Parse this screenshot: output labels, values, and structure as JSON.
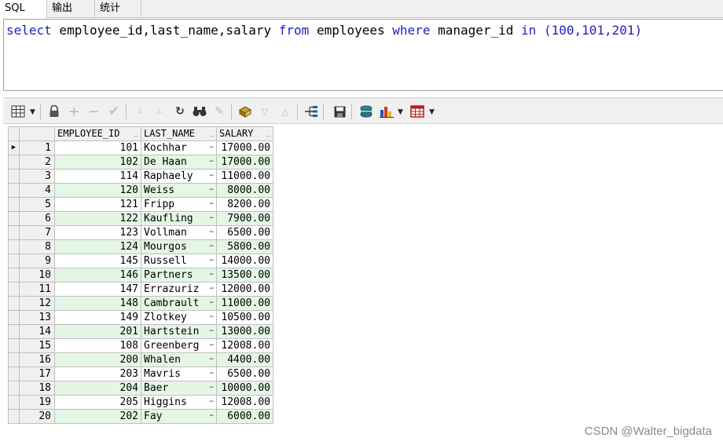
{
  "tabs": [
    "SQL",
    "输出",
    "统计"
  ],
  "sql": {
    "kw_select": "select",
    "cols": " employee_id,last_name,salary ",
    "kw_from": "from",
    "table": " employees ",
    "kw_where": "where",
    "cond": " manager_id ",
    "kw_in": "in",
    "list": " (100,101,201)"
  },
  "toolbar": {
    "icons": [
      "grid-icon",
      "lock-icon",
      "plus-icon",
      "minus-icon",
      "check-icon",
      "filter-down-icon",
      "filter-all-icon",
      "refresh-icon",
      "find-icon",
      "clear-icon",
      "query-icon",
      "down-icon",
      "up-icon",
      "explain-icon",
      "save-icon",
      "export-icon",
      "chart-icon",
      "table-icon"
    ]
  },
  "grid": {
    "columns": [
      "EMPLOYEE_ID",
      "LAST_NAME",
      "SALARY"
    ],
    "rows": [
      [
        "1",
        "101",
        "Kochhar",
        "17000.00"
      ],
      [
        "2",
        "102",
        "De Haan",
        "17000.00"
      ],
      [
        "3",
        "114",
        "Raphaely",
        "11000.00"
      ],
      [
        "4",
        "120",
        "Weiss",
        "8000.00"
      ],
      [
        "5",
        "121",
        "Fripp",
        "8200.00"
      ],
      [
        "6",
        "122",
        "Kaufling",
        "7900.00"
      ],
      [
        "7",
        "123",
        "Vollman",
        "6500.00"
      ],
      [
        "8",
        "124",
        "Mourgos",
        "5800.00"
      ],
      [
        "9",
        "145",
        "Russell",
        "14000.00"
      ],
      [
        "10",
        "146",
        "Partners",
        "13500.00"
      ],
      [
        "11",
        "147",
        "Errazuriz",
        "12000.00"
      ],
      [
        "12",
        "148",
        "Cambrault",
        "11000.00"
      ],
      [
        "13",
        "149",
        "Zlotkey",
        "10500.00"
      ],
      [
        "14",
        "201",
        "Hartstein",
        "13000.00"
      ],
      [
        "15",
        "108",
        "Greenberg",
        "12008.00"
      ],
      [
        "16",
        "200",
        "Whalen",
        "4400.00"
      ],
      [
        "17",
        "203",
        "Mavris",
        "6500.00"
      ],
      [
        "18",
        "204",
        "Baer",
        "10000.00"
      ],
      [
        "19",
        "205",
        "Higgins",
        "12008.00"
      ],
      [
        "20",
        "202",
        "Fay",
        "6000.00"
      ]
    ]
  },
  "watermark": "CSDN @Walter_bigdata"
}
